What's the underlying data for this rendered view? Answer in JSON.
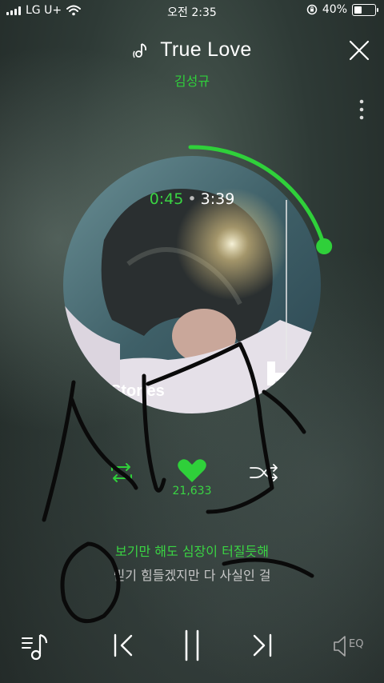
{
  "status_bar": {
    "carrier": "LG U+",
    "time": "오전 2:35",
    "battery_percent": "40%",
    "battery_level": 0.4
  },
  "player": {
    "title": "True Love",
    "artist": "김성규",
    "current_time": "0:45",
    "total_time": "3:39",
    "progress": 0.205,
    "album_art_text": "Stories",
    "like_count": "21,633",
    "colors": {
      "accent": "#2fd03a",
      "lyric_next": "#c8c8c8"
    }
  },
  "lyrics": {
    "current": "보기만 해도 심장이 터질듯해",
    "next": "믿기 힘들겠지만 다 사실인 걸"
  },
  "icons": {
    "close": "close-icon",
    "more": "more-vertical-icon",
    "note": "music-note-icon",
    "repeat": "repeat-icon",
    "like": "heart-icon",
    "shuffle": "shuffle-icon",
    "playlist": "playlist-icon",
    "prev": "previous-icon",
    "pause": "pause-icon",
    "next": "next-icon",
    "eq": "eq-icon"
  },
  "eq_label": "EQ"
}
